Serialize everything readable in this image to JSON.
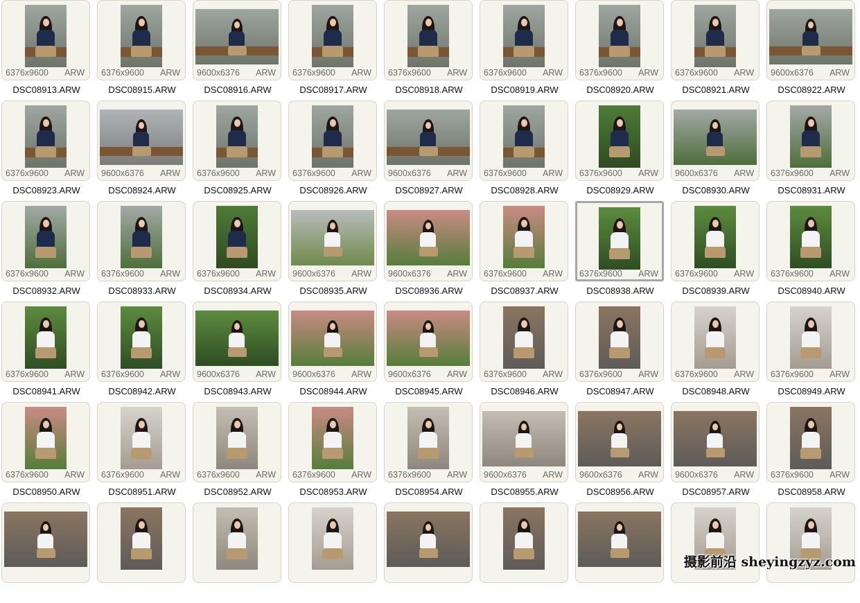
{
  "files": [
    {
      "name": "DSC08913.ARW",
      "dims": "6376x9600",
      "fmt": "ARW",
      "orientation": "portrait",
      "scene": "bench-blazer"
    },
    {
      "name": "DSC08915.ARW",
      "dims": "6376x9600",
      "fmt": "ARW",
      "orientation": "portrait",
      "scene": "bench-blazer"
    },
    {
      "name": "DSC08916.ARW",
      "dims": "9600x6376",
      "fmt": "ARW",
      "orientation": "landscape",
      "scene": "bench-blazer"
    },
    {
      "name": "DSC08917.ARW",
      "dims": "6376x9600",
      "fmt": "ARW",
      "orientation": "portrait",
      "scene": "bench-blazer"
    },
    {
      "name": "DSC08918.ARW",
      "dims": "6376x9600",
      "fmt": "ARW",
      "orientation": "portrait",
      "scene": "bench-blazer"
    },
    {
      "name": "DSC08919.ARW",
      "dims": "6376x9600",
      "fmt": "ARW",
      "orientation": "portrait",
      "scene": "bench-blazer"
    },
    {
      "name": "DSC08920.ARW",
      "dims": "6376x9600",
      "fmt": "ARW",
      "orientation": "portrait",
      "scene": "bench-blazer"
    },
    {
      "name": "DSC08921.ARW",
      "dims": "6376x9600",
      "fmt": "ARW",
      "orientation": "portrait",
      "scene": "bench-blazer"
    },
    {
      "name": "DSC08922.ARW",
      "dims": "9600x6376",
      "fmt": "ARW",
      "orientation": "landscape",
      "scene": "bench-blazer"
    },
    {
      "name": "DSC08923.ARW",
      "dims": "6376x9600",
      "fmt": "ARW",
      "orientation": "portrait",
      "scene": "bench-blazer"
    },
    {
      "name": "DSC08924.ARW",
      "dims": "9600x6376",
      "fmt": "ARW",
      "orientation": "landscape",
      "scene": "street-blazer"
    },
    {
      "name": "DSC08925.ARW",
      "dims": "6376x9600",
      "fmt": "ARW",
      "orientation": "portrait",
      "scene": "bench-blazer"
    },
    {
      "name": "DSC08926.ARW",
      "dims": "6376x9600",
      "fmt": "ARW",
      "orientation": "portrait",
      "scene": "bench-blazer"
    },
    {
      "name": "DSC08927.ARW",
      "dims": "9600x6376",
      "fmt": "ARW",
      "orientation": "landscape",
      "scene": "bench-blazer"
    },
    {
      "name": "DSC08928.ARW",
      "dims": "6376x9600",
      "fmt": "ARW",
      "orientation": "portrait",
      "scene": "bench-blazer"
    },
    {
      "name": "DSC08929.ARW",
      "dims": "6376x9600",
      "fmt": "ARW",
      "orientation": "portrait",
      "scene": "green-blazer"
    },
    {
      "name": "DSC08930.ARW",
      "dims": "9600x6376",
      "fmt": "ARW",
      "orientation": "landscape",
      "scene": "path-blazer"
    },
    {
      "name": "DSC08931.ARW",
      "dims": "6376x9600",
      "fmt": "ARW",
      "orientation": "portrait",
      "scene": "path-blazer"
    },
    {
      "name": "DSC08932.ARW",
      "dims": "6376x9600",
      "fmt": "ARW",
      "orientation": "portrait",
      "scene": "path-blazer"
    },
    {
      "name": "DSC08933.ARW",
      "dims": "6376x9600",
      "fmt": "ARW",
      "orientation": "portrait",
      "scene": "path-blazer"
    },
    {
      "name": "DSC08934.ARW",
      "dims": "6376x9600",
      "fmt": "ARW",
      "orientation": "portrait",
      "scene": "green-blazer"
    },
    {
      "name": "DSC08935.ARW",
      "dims": "9600x6376",
      "fmt": "ARW",
      "orientation": "landscape",
      "scene": "path-shirt"
    },
    {
      "name": "DSC08936.ARW",
      "dims": "9600x6376",
      "fmt": "ARW",
      "orientation": "landscape",
      "scene": "park-shirt"
    },
    {
      "name": "DSC08937.ARW",
      "dims": "6376x9600",
      "fmt": "ARW",
      "orientation": "portrait",
      "scene": "park-shirt"
    },
    {
      "name": "DSC08938.ARW",
      "dims": "6376x9600",
      "fmt": "ARW",
      "orientation": "portrait",
      "scene": "green-shirt",
      "selected": true
    },
    {
      "name": "DSC08939.ARW",
      "dims": "6376x9600",
      "fmt": "ARW",
      "orientation": "portrait",
      "scene": "green-shirt"
    },
    {
      "name": "DSC08940.ARW",
      "dims": "6376x9600",
      "fmt": "ARW",
      "orientation": "portrait",
      "scene": "green-shirt"
    },
    {
      "name": "DSC08941.ARW",
      "dims": "6376x9600",
      "fmt": "ARW",
      "orientation": "portrait",
      "scene": "green-shirt"
    },
    {
      "name": "DSC08942.ARW",
      "dims": "6376x9600",
      "fmt": "ARW",
      "orientation": "portrait",
      "scene": "green-shirt"
    },
    {
      "name": "DSC08943.ARW",
      "dims": "9600x6376",
      "fmt": "ARW",
      "orientation": "landscape",
      "scene": "green-shirt"
    },
    {
      "name": "DSC08944.ARW",
      "dims": "9600x6376",
      "fmt": "ARW",
      "orientation": "landscape",
      "scene": "park-shirt"
    },
    {
      "name": "DSC08945.ARW",
      "dims": "9600x6376",
      "fmt": "ARW",
      "orientation": "landscape",
      "scene": "park-shirt"
    },
    {
      "name": "DSC08946.ARW",
      "dims": "6376x9600",
      "fmt": "ARW",
      "orientation": "portrait",
      "scene": "shop-shirt"
    },
    {
      "name": "DSC08947.ARW",
      "dims": "6376x9600",
      "fmt": "ARW",
      "orientation": "portrait",
      "scene": "shop-shirt"
    },
    {
      "name": "DSC08948.ARW",
      "dims": "6376x9600",
      "fmt": "ARW",
      "orientation": "portrait",
      "scene": "street-shirt"
    },
    {
      "name": "DSC08949.ARW",
      "dims": "6376x9600",
      "fmt": "ARW",
      "orientation": "portrait",
      "scene": "street-shirt"
    },
    {
      "name": "DSC08950.ARW",
      "dims": "6376x9600",
      "fmt": "ARW",
      "orientation": "portrait",
      "scene": "park-shirt"
    },
    {
      "name": "DSC08951.ARW",
      "dims": "6376x9600",
      "fmt": "ARW",
      "orientation": "portrait",
      "scene": "street-shirt"
    },
    {
      "name": "DSC08952.ARW",
      "dims": "6376x9600",
      "fmt": "ARW",
      "orientation": "portrait",
      "scene": "closeup-shirt"
    },
    {
      "name": "DSC08953.ARW",
      "dims": "6376x9600",
      "fmt": "ARW",
      "orientation": "portrait",
      "scene": "park-shirt"
    },
    {
      "name": "DSC08954.ARW",
      "dims": "6376x9600",
      "fmt": "ARW",
      "orientation": "portrait",
      "scene": "closeup-shirt"
    },
    {
      "name": "DSC08955.ARW",
      "dims": "9600x6376",
      "fmt": "ARW",
      "orientation": "landscape",
      "scene": "closeup-shirt"
    },
    {
      "name": "DSC08956.ARW",
      "dims": "9600x6376",
      "fmt": "ARW",
      "orientation": "landscape",
      "scene": "shop-shirt"
    },
    {
      "name": "DSC08957.ARW",
      "dims": "9600x6376",
      "fmt": "ARW",
      "orientation": "landscape",
      "scene": "shop-shirt"
    },
    {
      "name": "DSC08958.ARW",
      "dims": "6376x9600",
      "fmt": "ARW",
      "orientation": "portrait",
      "scene": "shop-shirt"
    },
    {
      "name": "",
      "dims": "",
      "fmt": "",
      "orientation": "landscape",
      "scene": "shop-shirt",
      "partial": true
    },
    {
      "name": "",
      "dims": "",
      "fmt": "",
      "orientation": "portrait",
      "scene": "shop-shirt",
      "partial": true
    },
    {
      "name": "",
      "dims": "",
      "fmt": "",
      "orientation": "portrait",
      "scene": "closeup-shirt",
      "partial": true
    },
    {
      "name": "",
      "dims": "",
      "fmt": "",
      "orientation": "portrait",
      "scene": "street-shirt",
      "partial": true
    },
    {
      "name": "",
      "dims": "",
      "fmt": "",
      "orientation": "landscape",
      "scene": "shop-shirt",
      "partial": true
    },
    {
      "name": "",
      "dims": "",
      "fmt": "",
      "orientation": "portrait",
      "scene": "shop-shirt",
      "partial": true
    },
    {
      "name": "",
      "dims": "",
      "fmt": "",
      "orientation": "landscape",
      "scene": "shop-shirt",
      "partial": true
    },
    {
      "name": "",
      "dims": "",
      "fmt": "",
      "orientation": "portrait",
      "scene": "street-shirt",
      "partial": true
    },
    {
      "name": "",
      "dims": "",
      "fmt": "",
      "orientation": "portrait",
      "scene": "street-shirt",
      "partial": true
    }
  ],
  "watermark": "摄影前沿 sheyingzyz.com",
  "colors": {
    "page_bg": "#ffffff",
    "card_bg": "#f4f3ec",
    "card_border": "#d6d4c6",
    "selected_border": "#a6a6a6",
    "meta_text": "#6a6a6a",
    "name_text": "#111111"
  },
  "scene_palettes": {
    "bench-blazer": {
      "bg": [
        "#9ea6a0",
        "#6d7469"
      ],
      "top": "#1f2b4a",
      "bench": true
    },
    "street-blazer": {
      "bg": [
        "#b0b4b6",
        "#7b7d7a"
      ],
      "top": "#1f2b4a",
      "bench": true
    },
    "green-blazer": {
      "bg": [
        "#4f7b38",
        "#2f4a22"
      ],
      "top": "#1f2b4a",
      "bench": false
    },
    "path-blazer": {
      "bg": [
        "#a3a9a6",
        "#4e6e3c"
      ],
      "top": "#1f2b4a",
      "bench": false
    },
    "path-shirt": {
      "bg": [
        "#b9bcbc",
        "#6f8a4c"
      ],
      "top": "#f3f3f3",
      "bench": false
    },
    "park-shirt": {
      "bg": [
        "#c98b84",
        "#567d3b"
      ],
      "top": "#f3f3f3",
      "bench": false
    },
    "green-shirt": {
      "bg": [
        "#5d8b3f",
        "#2f4d24"
      ],
      "top": "#f3f3f3",
      "bench": false
    },
    "shop-shirt": {
      "bg": [
        "#8a7560",
        "#5e5b5a"
      ],
      "top": "#f3f3f3",
      "bench": false
    },
    "street-shirt": {
      "bg": [
        "#d6d2cc",
        "#a49c92"
      ],
      "top": "#f3f3f3",
      "bench": false
    },
    "closeup-shirt": {
      "bg": [
        "#c4bdb3",
        "#8d877f"
      ],
      "top": "#f3f3f3",
      "bench": false
    }
  }
}
